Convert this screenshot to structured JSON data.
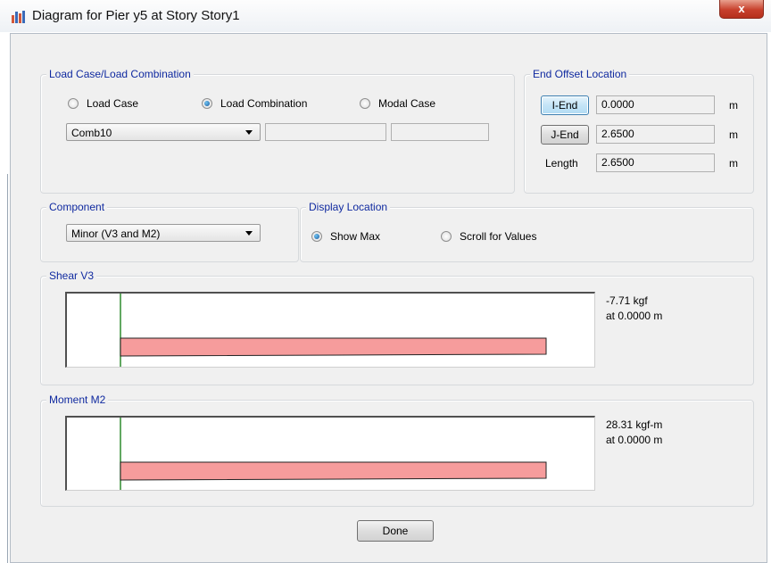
{
  "window": {
    "title": "Diagram for Pier y5 at Story Story1",
    "close_label": "x"
  },
  "load_group": {
    "legend": "Load Case/Load Combination",
    "options": [
      {
        "label": "Load Case",
        "selected": false
      },
      {
        "label": "Load Combination",
        "selected": true
      },
      {
        "label": "Modal Case",
        "selected": false
      }
    ],
    "combo_value": "Comb10",
    "extra_fields": [
      "",
      ""
    ]
  },
  "offset_group": {
    "legend": "End Offset Location",
    "i_end_label": "I-End",
    "i_end_value": "0.0000",
    "j_end_label": "J-End",
    "j_end_value": "2.6500",
    "length_label": "Length",
    "length_value": "2.6500",
    "unit": "m"
  },
  "component_group": {
    "legend": "Component",
    "value": "Minor (V3 and M2)"
  },
  "display_group": {
    "legend": "Display Location",
    "options": [
      {
        "label": "Show Max",
        "selected": true
      },
      {
        "label": "Scroll for Values",
        "selected": false
      }
    ]
  },
  "shear_group": {
    "legend": "Shear V3",
    "value_text": "-7.71 kgf",
    "location_text": "at 0.0000 m",
    "chart_data": {
      "type": "area",
      "x": [
        0,
        2.65
      ],
      "y": [
        -7.71,
        0.0
      ]
    }
  },
  "moment_group": {
    "legend": "Moment M2",
    "value_text": "28.31 kgf-m",
    "location_text": "at 0.0000 m",
    "chart_data": {
      "type": "area",
      "x": [
        0,
        2.65
      ],
      "y": [
        28.31,
        0.0
      ]
    }
  },
  "done_label": "Done",
  "colors": {
    "diagram_fill": "#f69c9c",
    "diagram_stroke": "#222222",
    "axis": "#2e8b2e",
    "legend": "#102aa0"
  }
}
